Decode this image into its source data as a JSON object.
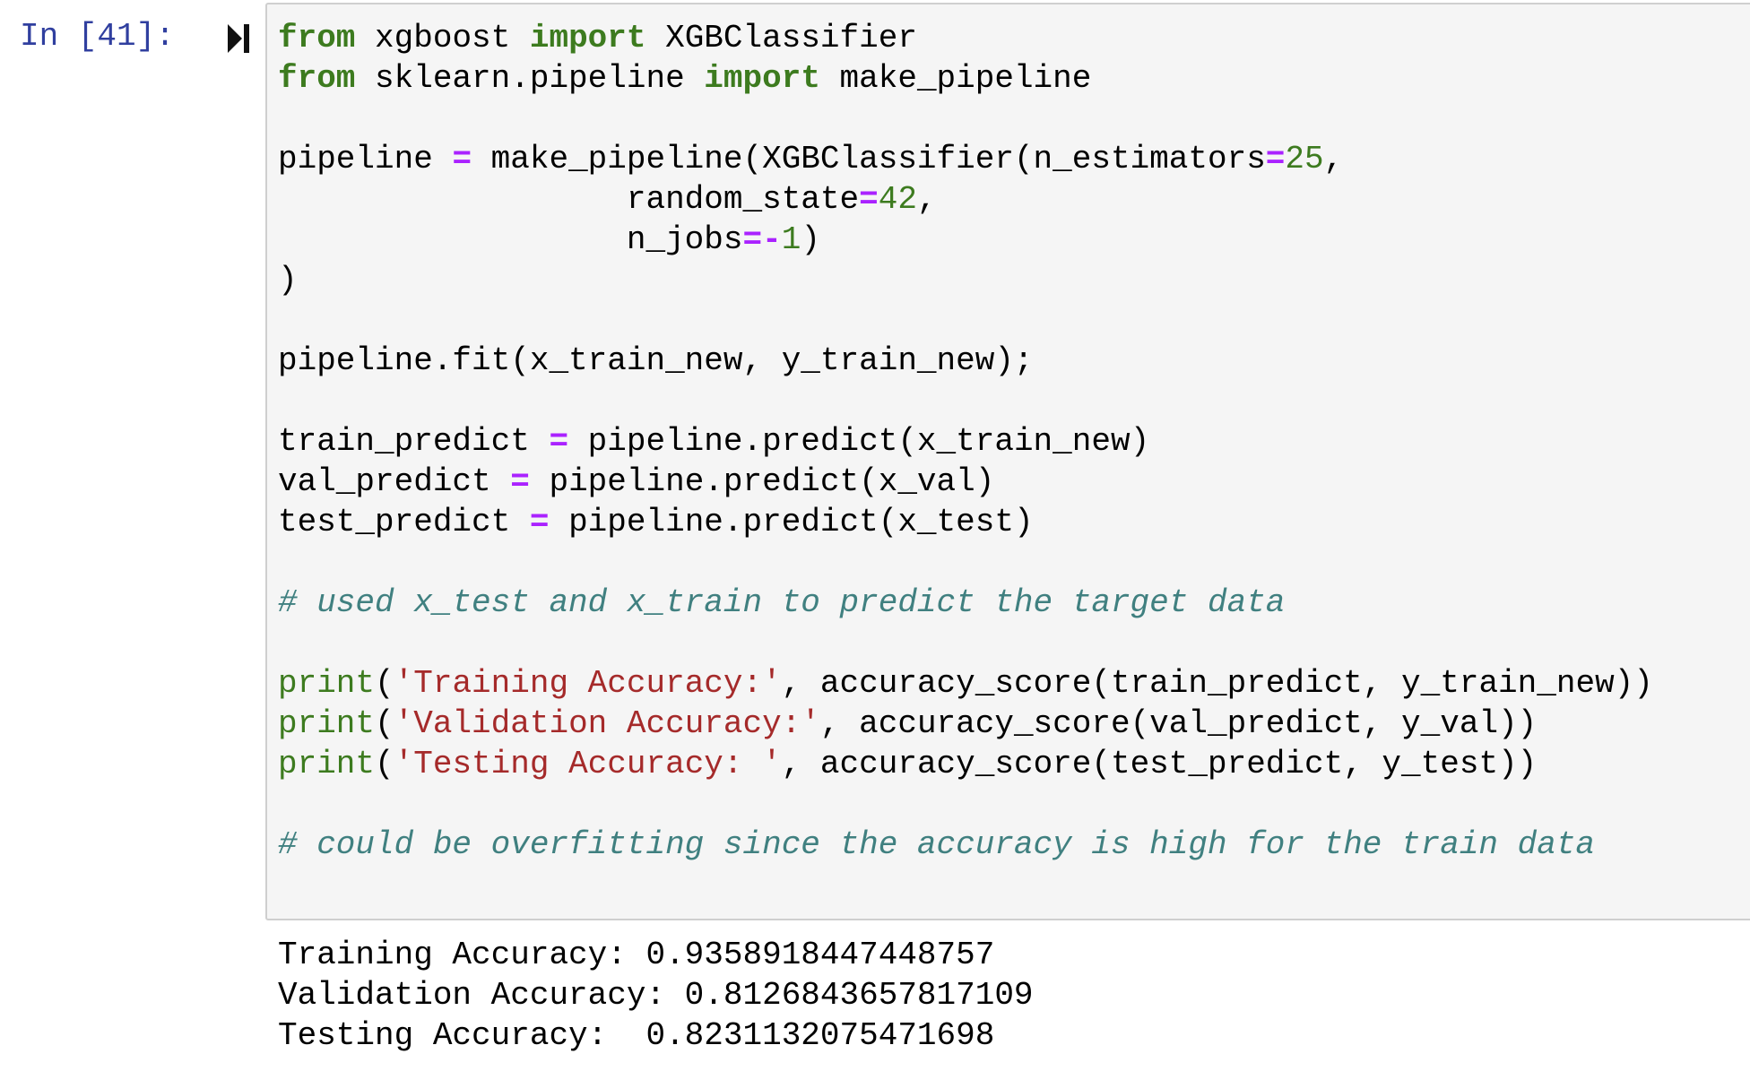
{
  "cell": {
    "prompt": "In [41]:",
    "run_icon": "run-cell-icon",
    "code": {
      "line1": {
        "kw1": "from",
        "mod": " xgboost ",
        "kw2": "import",
        "name": " XGBClassifier"
      },
      "line2": {
        "kw1": "from",
        "mod": " sklearn.pipeline ",
        "kw2": "import",
        "name": " make_pipeline"
      },
      "line4": {
        "a": "pipeline ",
        "op1": "=",
        "b": " make_pipeline(XGBClassifier(n_estimators",
        "op2": "=",
        "num": "25",
        "c": ","
      },
      "line5": {
        "a": "                  random_state",
        "op": "=",
        "num": "42",
        "c": ","
      },
      "line6": {
        "a": "                  n_jobs",
        "op": "=-",
        "num": "1",
        "c": ")"
      },
      "line7": ")",
      "line9": "pipeline.fit(x_train_new, y_train_new);",
      "line11": {
        "a": "train_predict ",
        "op": "=",
        "b": " pipeline.predict(x_train_new)"
      },
      "line12": {
        "a": "val_predict ",
        "op": "=",
        "b": " pipeline.predict(x_val)"
      },
      "line13": {
        "a": "test_predict ",
        "op": "=",
        "b": " pipeline.predict(x_test)"
      },
      "line15": "# used x_test and x_train to predict the target data",
      "line17": {
        "fn": "print",
        "p": "(",
        "str": "'Training Accuracy:'",
        "rest": ", accuracy_score(train_predict, y_train_new))"
      },
      "line18": {
        "fn": "print",
        "p": "(",
        "str": "'Validation Accuracy:'",
        "rest": ", accuracy_score(val_predict, y_val))"
      },
      "line19": {
        "fn": "print",
        "p": "(",
        "str": "'Testing Accuracy: '",
        "rest": ", accuracy_score(test_predict, y_test))"
      },
      "line21": "# could be overfitting since the accuracy is high for the train data"
    },
    "output": {
      "line1": "Training Accuracy: 0.9358918447448757",
      "line2": "Validation Accuracy: 0.8126843657817109",
      "line3": "Testing Accuracy:  0.8231132075471698"
    }
  }
}
